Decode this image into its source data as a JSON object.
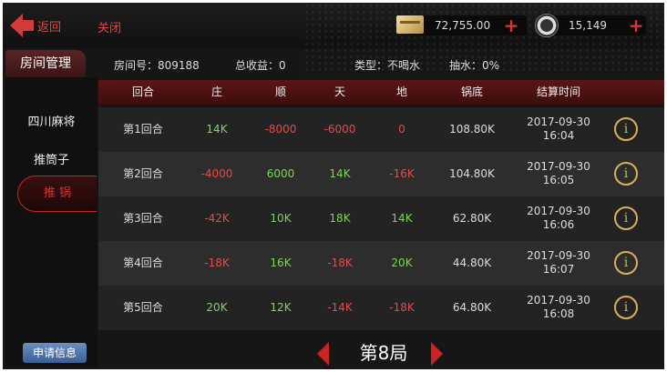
{
  "header": {
    "back_label": "返回",
    "close_label": "关闭",
    "coins": "72,755.00",
    "chips": "15,149"
  },
  "info": {
    "room_number": "房间号：809188",
    "total_income": "总收益：0",
    "type": "类型：不喝水",
    "rake": "抽水：0%"
  },
  "sidebar": {
    "title": "房间管理",
    "items": [
      {
        "label": "四川麻将"
      },
      {
        "label": "推筒子"
      },
      {
        "label": "推 锅"
      }
    ],
    "apply_label": "申请信息"
  },
  "table": {
    "columns": [
      "回合",
      "庄",
      "顺",
      "天",
      "地",
      "锅底",
      "结算时间"
    ],
    "rows": [
      {
        "round": "第1回合",
        "zhuang": "14K",
        "shun": "-8000",
        "tian": "-6000",
        "di": "0",
        "pot": "108.80K",
        "date": "2017-09-30",
        "time": "16:04"
      },
      {
        "round": "第2回合",
        "zhuang": "-4000",
        "shun": "6000",
        "tian": "14K",
        "di": "-16K",
        "pot": "104.80K",
        "date": "2017-09-30",
        "time": "16:05"
      },
      {
        "round": "第3回合",
        "zhuang": "-42K",
        "shun": "10K",
        "tian": "18K",
        "di": "14K",
        "pot": "62.80K",
        "date": "2017-09-30",
        "time": "16:06"
      },
      {
        "round": "第4回合",
        "zhuang": "-18K",
        "shun": "16K",
        "tian": "-18K",
        "di": "20K",
        "pot": "44.80K",
        "date": "2017-09-30",
        "time": "16:07"
      },
      {
        "round": "第5回合",
        "zhuang": "20K",
        "shun": "12K",
        "tian": "-14K",
        "di": "-18K",
        "pot": "64.80K",
        "date": "2017-09-30",
        "time": "16:08"
      }
    ]
  },
  "pager": {
    "label": "第8局"
  },
  "colors": {
    "accent": "#d33333",
    "positive": "#7fd45a",
    "negative": "#e54a4a",
    "header_bg": "#5c1616",
    "info_icon": "#d7b25a"
  }
}
